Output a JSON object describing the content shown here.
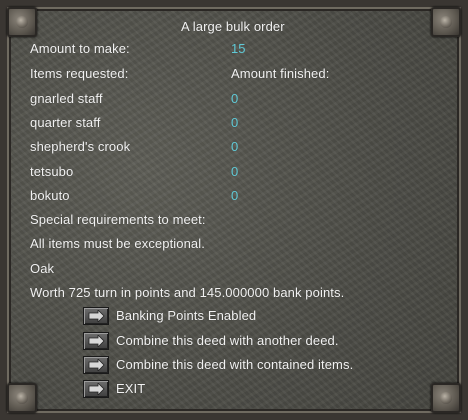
{
  "title": "A large bulk order",
  "amount_label": "Amount to make:",
  "amount_value": "15",
  "items_header_left": "Items requested:",
  "items_header_right": "Amount finished:",
  "items": [
    {
      "name": "gnarled staff",
      "finished": "0"
    },
    {
      "name": "quarter staff",
      "finished": "0"
    },
    {
      "name": "shepherd's crook",
      "finished": "0"
    },
    {
      "name": "tetsubo",
      "finished": "0"
    },
    {
      "name": "bokuto",
      "finished": "0"
    }
  ],
  "requirements_label": "Special requirements to meet:",
  "requirement_exceptional": "All items must be exceptional.",
  "material": "Oak",
  "worth": "Worth 725  turn in points and 145.000000 bank points.",
  "options": [
    {
      "label": "Banking Points Enabled",
      "icon": "arrow-button-icon"
    },
    {
      "label": "Combine this deed with another deed.",
      "icon": "arrow-button-icon"
    },
    {
      "label": "Combine this deed with contained items.",
      "icon": "arrow-button-icon"
    },
    {
      "label": "EXIT",
      "icon": "arrow-button-icon"
    }
  ],
  "colors": {
    "text": "#f2f2f2",
    "value": "#5fc9d6",
    "panel": "#55554e"
  }
}
